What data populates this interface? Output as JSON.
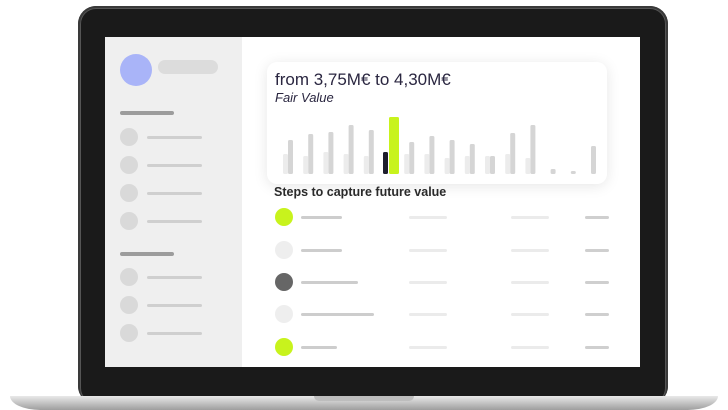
{
  "valuation": {
    "title": "from 3,75M€ to 4,30M€",
    "subtitle": "Fair Value"
  },
  "steps": {
    "heading": "Steps to capture future value",
    "rows": [
      {
        "status": "complete",
        "color": "#c8f31d"
      },
      {
        "status": "pending",
        "color": "#eeeeee"
      },
      {
        "status": "in-progress",
        "color": "#666666"
      },
      {
        "status": "pending",
        "color": "#eeeeee"
      },
      {
        "status": "complete",
        "color": "#c8f31d"
      }
    ]
  },
  "colors": {
    "accent": "#c8f31d",
    "avatar": "#a9b4f8",
    "dark_bar": "#1e1e2e",
    "text": "#2a2640"
  },
  "chart_data": {
    "type": "bar",
    "title": "",
    "series": [
      {
        "values": [
          34,
          40,
          42,
          49,
          44,
          57,
          32,
          38,
          34,
          30,
          18,
          41,
          49,
          5,
          3,
          28
        ]
      },
      {
        "values": [
          20,
          18,
          22,
          20,
          18,
          22,
          20,
          20,
          16,
          18,
          18,
          20,
          16,
          0,
          0,
          0
        ]
      }
    ],
    "highlight_index": 5,
    "highlight_colors": [
      "#c8f31d",
      "#1e1e2e"
    ],
    "ylim": [
      0,
      60
    ],
    "grid": false
  }
}
